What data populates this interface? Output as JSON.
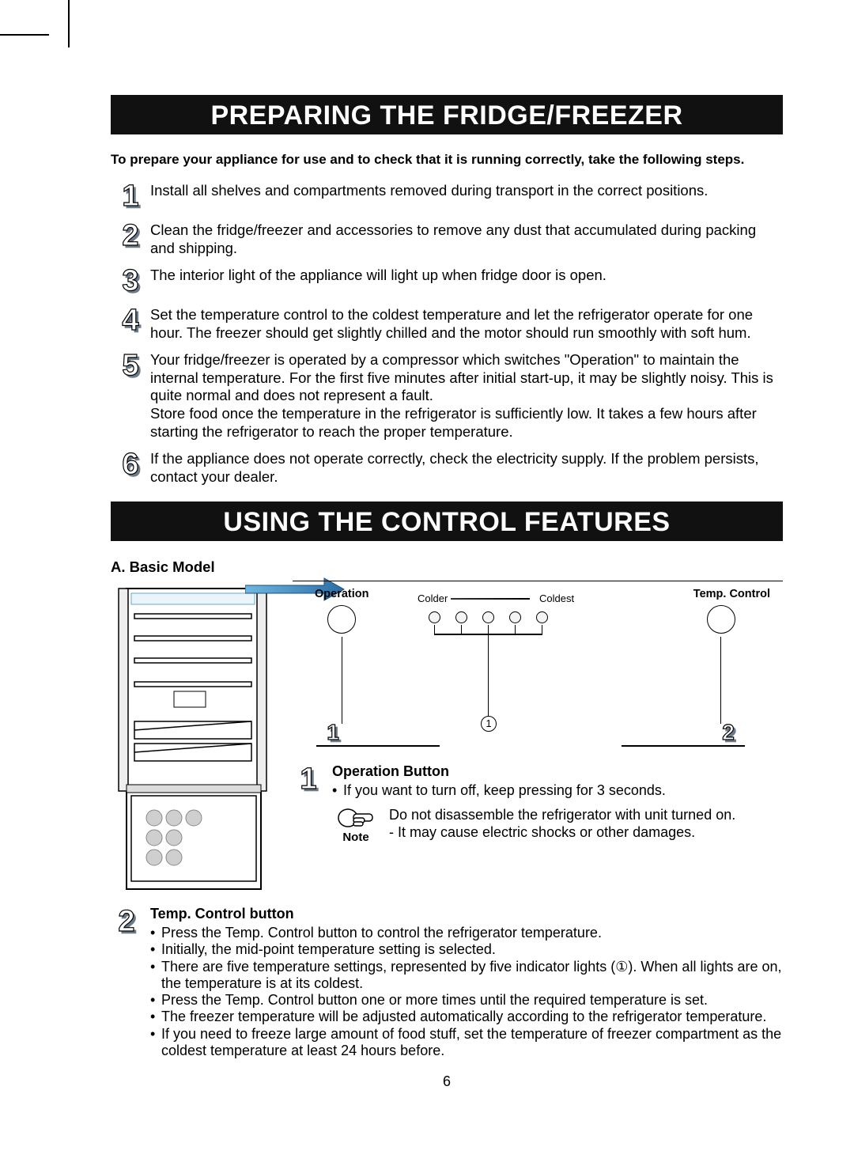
{
  "page_number": "6",
  "headings": {
    "h1": "PREPARING THE FRIDGE/FREEZER",
    "h2": "USING THE CONTROL FEATURES"
  },
  "intro": "To prepare your appliance for use and to check that it is running correctly, take the following steps.",
  "steps": [
    {
      "n": "1",
      "text": "Install all shelves and compartments removed during transport in the correct positions."
    },
    {
      "n": "2",
      "text": "Clean the fridge/freezer and accessories to remove any dust that accumulated during packing and shipping."
    },
    {
      "n": "3",
      "text": "The interior light of the appliance will light up when fridge door is open."
    },
    {
      "n": "4",
      "text": "Set the temperature control to the coldest temperature and let the refrigerator operate for one hour. The freezer should get slightly chilled and the motor should run smoothly with soft hum."
    },
    {
      "n": "5",
      "text": "Your fridge/freezer is operated by a compressor which switches \"Operation\" to maintain the internal temperature. For the first five minutes after initial start-up, it may be slightly noisy. This is quite normal and does not represent a fault.\nStore food once the temperature in the refrigerator is sufficiently low. It takes a few hours after starting the refrigerator to reach the proper temperature."
    },
    {
      "n": "6",
      "text": "If the appliance does not operate correctly, check the electricity supply. If the problem persists, contact your dealer."
    }
  ],
  "basic_model": {
    "title": "A. Basic Model",
    "panel": {
      "operation": "Operation",
      "temp_control": "Temp. Control",
      "colder": "Colder",
      "coldest": "Coldest",
      "callout_1": "1",
      "callout_2": "2",
      "indicator_ref": "1"
    },
    "feature1": {
      "n": "1",
      "title": "Operation Button",
      "bullets": [
        "If you want to turn off, keep pressing for 3 seconds."
      ],
      "note_label": "Note",
      "note_lines": [
        "Do not disassemble the refrigerator with unit turned on.",
        "- It may cause electric shocks or other damages."
      ]
    },
    "feature2": {
      "n": "2",
      "title": "Temp. Control button",
      "bullets": [
        "Press the Temp. Control button to control the refrigerator temperature.",
        "Initially, the mid-point temperature setting is selected.",
        "There are five temperature settings, represented by five indicator lights (①). When all lights are on, the temperature is at its coldest.",
        "Press the Temp. Control button one or more times until the required temperature is set.",
        "The freezer temperature will be adjusted automatically according to the refrigerator temperature.",
        "If you need to freeze large amount of food stuff, set the temperature of freezer compartment as the coldest temperature at least 24 hours before."
      ]
    }
  }
}
